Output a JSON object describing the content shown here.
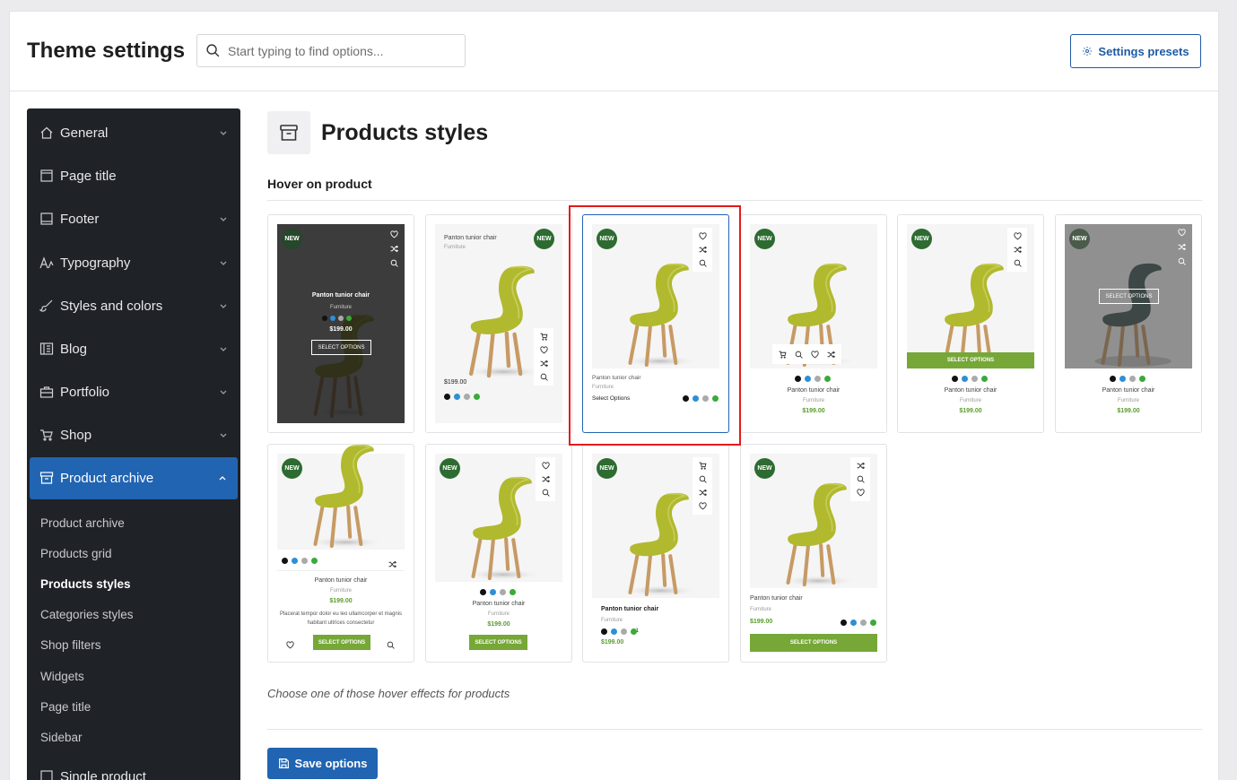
{
  "header": {
    "title": "Theme settings",
    "search_placeholder": "Start typing to find options...",
    "presets_label": "Settings presets"
  },
  "sidebar": {
    "items": [
      {
        "label": "General",
        "icon": "home-icon"
      },
      {
        "label": "Page title",
        "icon": "page-icon"
      },
      {
        "label": "Footer",
        "icon": "footer-icon"
      },
      {
        "label": "Typography",
        "icon": "typography-icon"
      },
      {
        "label": "Styles and colors",
        "icon": "brush-icon"
      },
      {
        "label": "Blog",
        "icon": "blog-icon"
      },
      {
        "label": "Portfolio",
        "icon": "briefcase-icon"
      },
      {
        "label": "Shop",
        "icon": "cart-icon"
      },
      {
        "label": "Product archive",
        "icon": "archive-icon"
      }
    ],
    "subitems": [
      "Product archive",
      "Products grid",
      "Products styles",
      "Categories styles",
      "Shop filters",
      "Widgets",
      "Page title",
      "Sidebar"
    ],
    "current_subitem": "Products styles",
    "next_item": "Single product"
  },
  "main": {
    "title": "Products styles",
    "section_label": "Hover on product",
    "hint": "Choose one of those hover effects for products",
    "save_label": "Save options"
  },
  "product": {
    "badge": "NEW",
    "name": "Panton tunior chair",
    "category": "Furniture",
    "price": "$199.00",
    "cta_upper": "SELECT OPTIONS",
    "cta_title": "Select Options",
    "description": "Placerat tempor dolor eu leo ullamcorper et magnis habitant ultrices consectetur",
    "extra_colors": "+1",
    "swatches": [
      "#111111",
      "#2e8fd6",
      "#aaaaaa",
      "#3aaa3a"
    ]
  },
  "colors": {
    "accent": "#2164b2",
    "sidebar_bg": "#1f2227",
    "badge_green": "#2d6b31",
    "cta_green": "#76a737",
    "price_green": "#5a9c2c",
    "highlight_red": "#e31b1b"
  }
}
